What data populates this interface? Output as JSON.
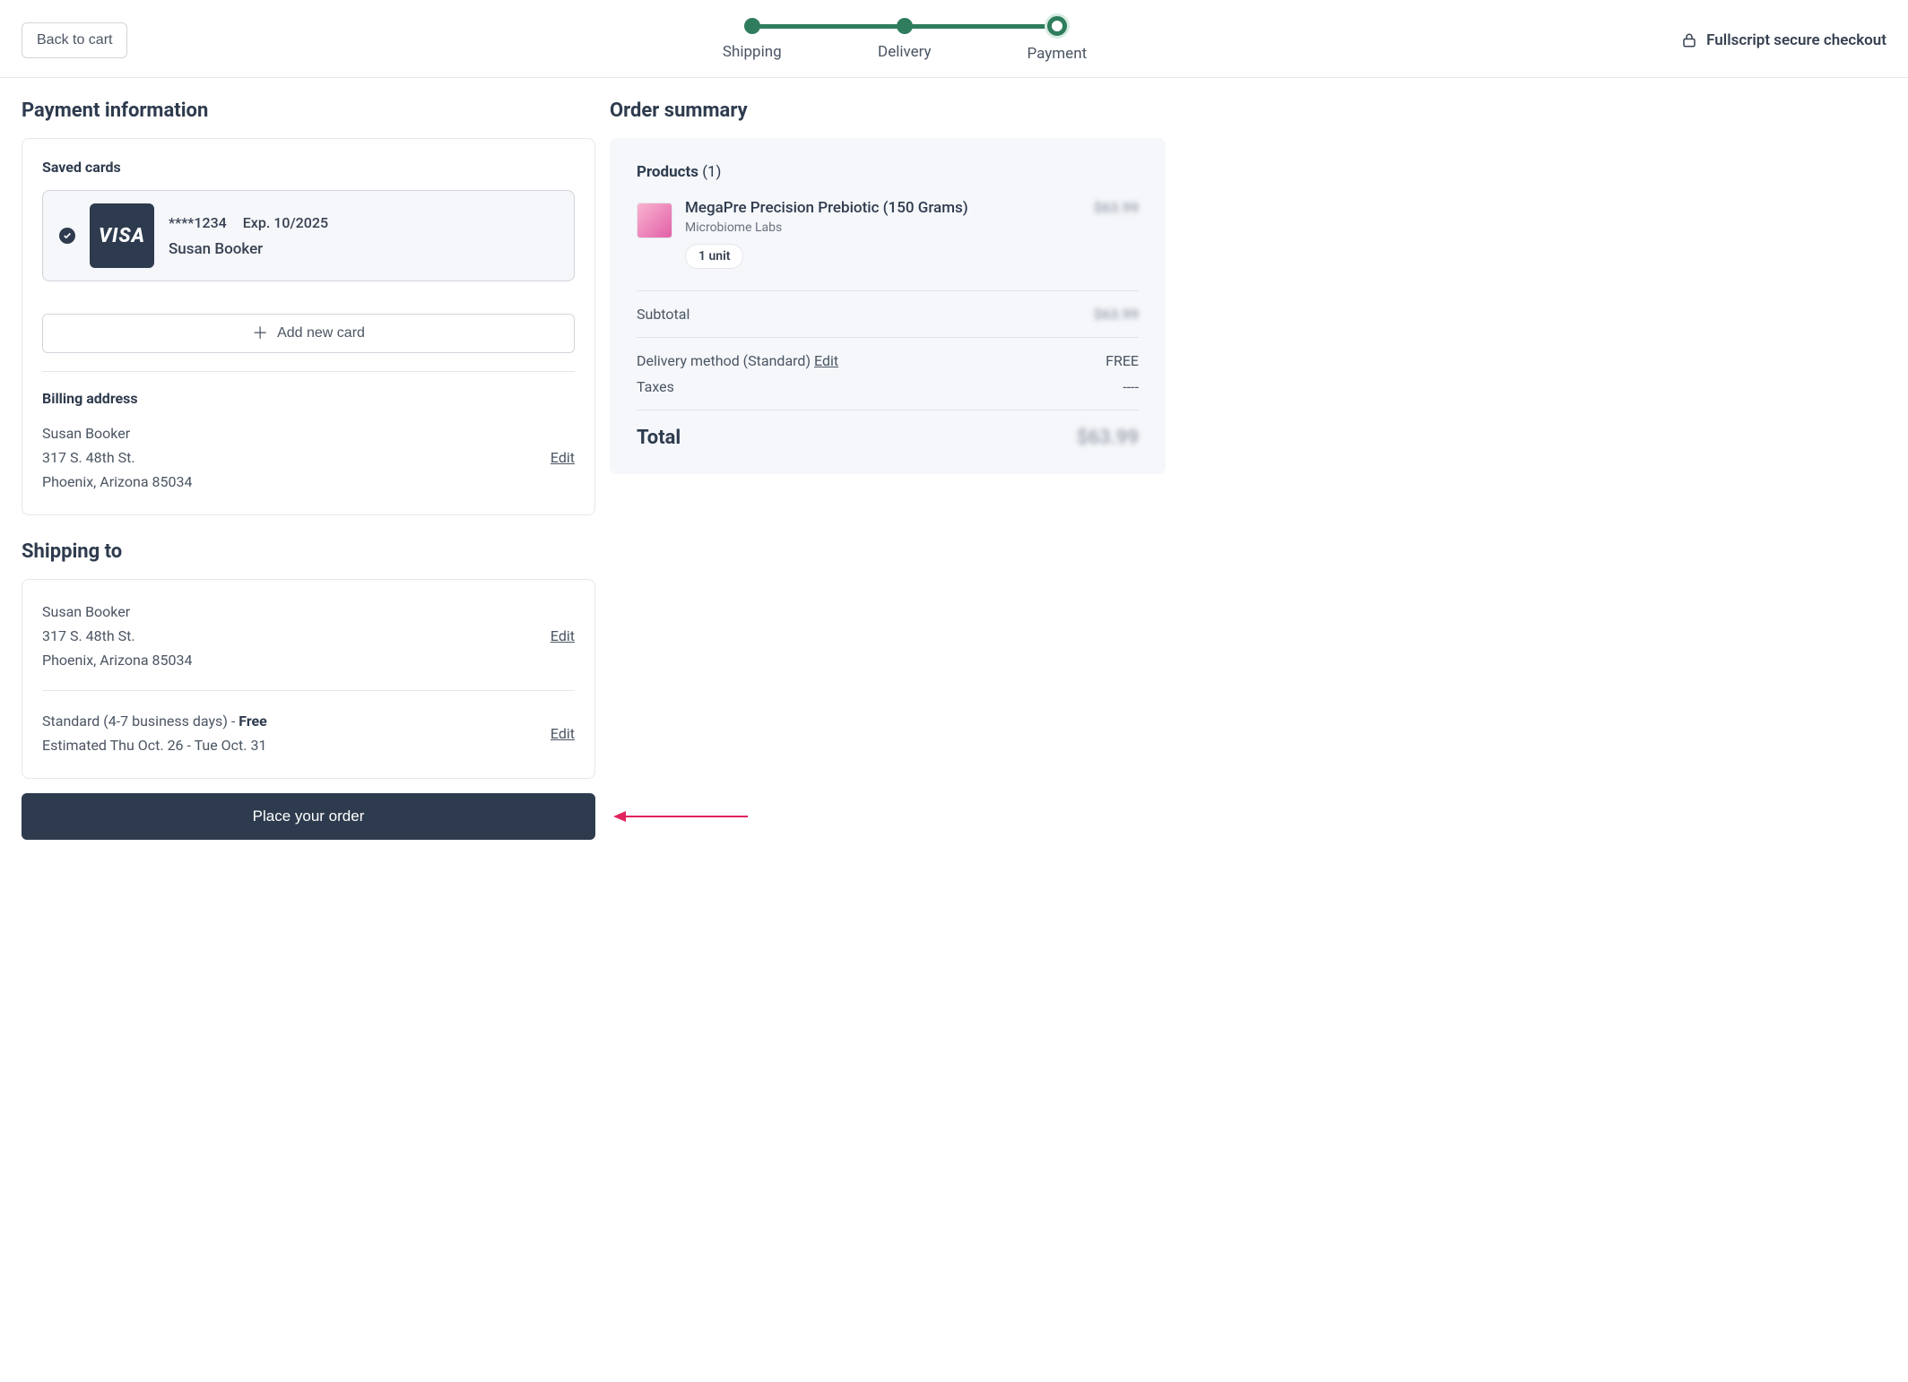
{
  "header": {
    "back_to_cart": "Back to cart",
    "secure_text": "Fullscript secure checkout",
    "steps": [
      "Shipping",
      "Delivery",
      "Payment"
    ]
  },
  "payment": {
    "title": "Payment information",
    "saved_cards_label": "Saved cards",
    "card": {
      "brand": "VISA",
      "masked": "****1234",
      "exp": "Exp. 10/2025",
      "name": "Susan Booker"
    },
    "add_new_card": "Add new card",
    "billing_label": "Billing address",
    "billing": {
      "name": "Susan Booker",
      "line1": "317 S. 48th St.",
      "line2": "Phoenix, Arizona 85034"
    },
    "edit": "Edit"
  },
  "shipping": {
    "title": "Shipping to",
    "addr": {
      "name": "Susan Booker",
      "line1": "317 S. 48th St.",
      "line2": "Phoenix, Arizona 85034"
    },
    "method_prefix": "Standard (4-7 business days) - ",
    "method_free": "Free",
    "estimate": "Estimated Thu Oct. 26 - Tue Oct. 31",
    "edit": "Edit"
  },
  "place_order": "Place your order",
  "summary": {
    "title": "Order summary",
    "products_label": "Products",
    "products_count": "(1)",
    "product": {
      "name": "MegaPre Precision Prebiotic (150 Grams)",
      "brand": "Microbiome Labs",
      "unit": "1 unit",
      "price": "$63.99"
    },
    "subtotal_label": "Subtotal",
    "subtotal_value": "$63.99",
    "delivery_label": "Delivery method (Standard) ",
    "delivery_edit": "Edit",
    "delivery_value": "FREE",
    "taxes_label": "Taxes",
    "taxes_value": "----",
    "total_label": "Total",
    "total_value": "$63.99"
  }
}
